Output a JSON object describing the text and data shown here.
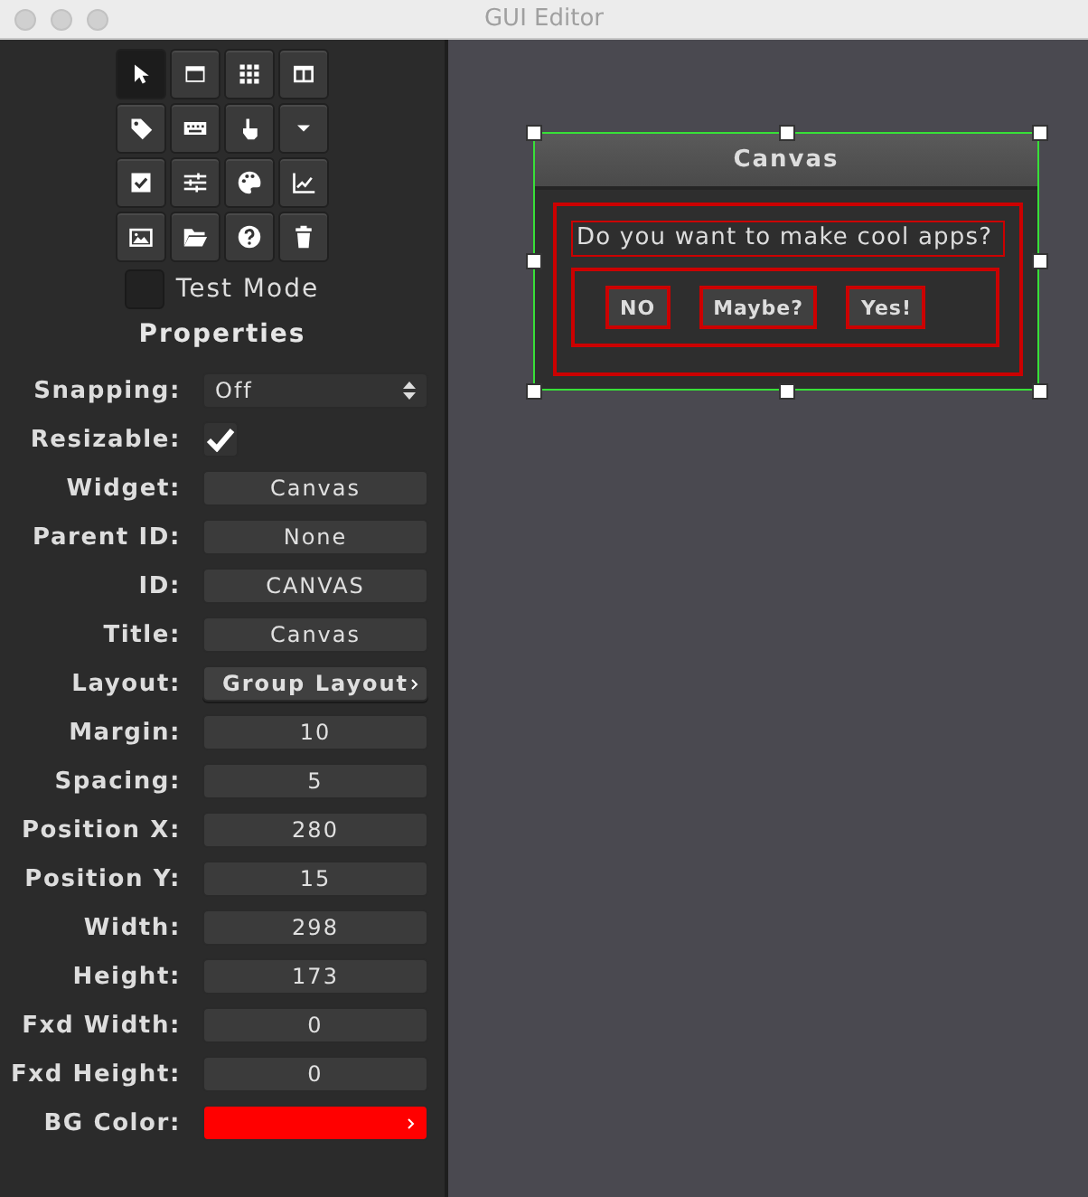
{
  "window": {
    "title": "GUI Editor"
  },
  "tools": [
    {
      "kind": "pointer",
      "selected": true
    },
    {
      "kind": "window",
      "selected": false
    },
    {
      "kind": "grid",
      "selected": false
    },
    {
      "kind": "columns",
      "selected": false
    },
    {
      "kind": "tag",
      "selected": false
    },
    {
      "kind": "keyboard",
      "selected": false
    },
    {
      "kind": "hand",
      "selected": false
    },
    {
      "kind": "caret",
      "selected": false
    },
    {
      "kind": "checkbox",
      "selected": false
    },
    {
      "kind": "sliders",
      "selected": false
    },
    {
      "kind": "palette",
      "selected": false
    },
    {
      "kind": "chart",
      "selected": false
    },
    {
      "kind": "image",
      "selected": false
    },
    {
      "kind": "folder",
      "selected": false
    },
    {
      "kind": "help",
      "selected": false
    },
    {
      "kind": "trash",
      "selected": false
    }
  ],
  "test_mode": {
    "label": "Test Mode",
    "checked": false
  },
  "properties_title": "Properties",
  "properties": [
    {
      "label": "Snapping:",
      "kind": "select",
      "value": "Off"
    },
    {
      "label": "Resizable:",
      "kind": "checkbox",
      "checked": true
    },
    {
      "label": "Widget:",
      "kind": "field",
      "value": "Canvas"
    },
    {
      "label": "Parent ID:",
      "kind": "field",
      "value": "None"
    },
    {
      "label": "ID:",
      "kind": "field",
      "value": "CANVAS"
    },
    {
      "label": "Title:",
      "kind": "field",
      "value": "Canvas"
    },
    {
      "label": "Layout:",
      "kind": "button",
      "value": "Group Layout"
    },
    {
      "label": "Margin:",
      "kind": "field",
      "value": "10"
    },
    {
      "label": "Spacing:",
      "kind": "field",
      "value": "5"
    },
    {
      "label": "Position X:",
      "kind": "field",
      "value": "280"
    },
    {
      "label": "Position Y:",
      "kind": "field",
      "value": "15"
    },
    {
      "label": "Width:",
      "kind": "field",
      "value": "298"
    },
    {
      "label": "Height:",
      "kind": "field",
      "value": "173"
    },
    {
      "label": "Fxd Width:",
      "kind": "field",
      "value": "0"
    },
    {
      "label": "Fxd Height:",
      "kind": "field",
      "value": "0"
    },
    {
      "label": "BG Color:",
      "kind": "color",
      "color": "#ff0000"
    }
  ],
  "canvas": {
    "title": "Canvas",
    "label": "Do you want to make cool apps?",
    "buttons": [
      "NO",
      "Maybe?",
      "Yes!"
    ]
  }
}
